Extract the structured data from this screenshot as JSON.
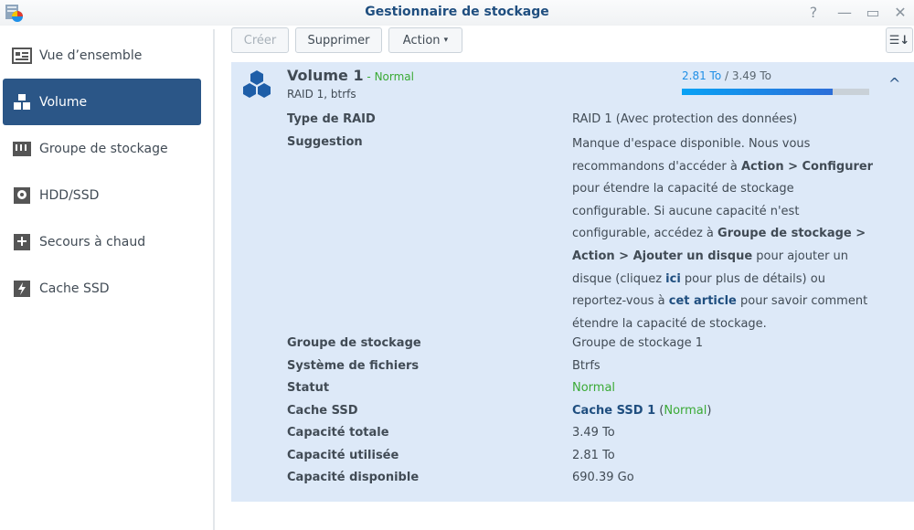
{
  "window": {
    "title": "Gestionnaire de stockage",
    "help": "?",
    "minimize": "—",
    "maximize": "▭",
    "close": "✕"
  },
  "sidebar": {
    "items": [
      {
        "label": "Vue d’ensemble",
        "icon": "overview-icon"
      },
      {
        "label": "Volume",
        "icon": "volume-icon",
        "active": true
      },
      {
        "label": "Groupe de stockage",
        "icon": "storage-pool-icon"
      },
      {
        "label": "HDD/SSD",
        "icon": "hdd-icon"
      },
      {
        "label": "Secours à chaud",
        "icon": "hot-spare-icon"
      },
      {
        "label": "Cache SSD",
        "icon": "ssd-cache-icon"
      }
    ]
  },
  "toolbar": {
    "create": "Créer",
    "delete": "Supprimer",
    "action": "Action",
    "action_caret": "▾",
    "sort_icon": "☰↓"
  },
  "volume": {
    "name": "Volume 1",
    "status_sep": " - ",
    "status": "Normal",
    "subtitle": "RAID 1, btrfs",
    "used": "2.81 To",
    "separator": " / ",
    "total": "3.49 To",
    "usage_percent": 80.5,
    "collapse": "^",
    "details": {
      "raid_type_label": "Type de RAID",
      "raid_type": "RAID 1 (Avec protection des données)",
      "suggestion_label": "Suggestion",
      "suggestion": [
        {
          "t": "Manque d'espace disponible. Nous vous recommandons d'accéder à "
        },
        {
          "t": "Action > Configurer",
          "b": 1
        },
        {
          "t": " pour étendre la capacité de stockage configurable. Si aucune capacité n'est configurable, accédez à "
        },
        {
          "t": "Groupe de stockage > Action > Ajouter un disque",
          "b": 1
        },
        {
          "t": " pour ajouter un disque (cliquez "
        },
        {
          "t": "ici",
          "l": 1
        },
        {
          "t": " pour plus de détails) ou reportez-vous à "
        },
        {
          "t": "cet article",
          "l": 1
        },
        {
          "t": " pour savoir comment étendre la capacité de stockage."
        }
      ],
      "pool_label": "Groupe de stockage",
      "pool": "Groupe de stockage 1",
      "fs_label": "Système de fichiers",
      "fs": "Btrfs",
      "status_label": "Statut",
      "status": "Normal",
      "cache_label": "Cache SSD",
      "cache": "Cache SSD 1",
      "cache_open": " (",
      "cache_status": "Normal",
      "cache_close": ")",
      "total_label": "Capacité totale",
      "total": "3.49 To",
      "used_label": "Capacité utilisée",
      "used": "2.81 To",
      "free_label": "Capacité disponible",
      "free": "690.39 Go"
    }
  },
  "colors": {
    "accent": "#2b5687",
    "green": "#3aaa35",
    "panel": "#dde9f8"
  }
}
